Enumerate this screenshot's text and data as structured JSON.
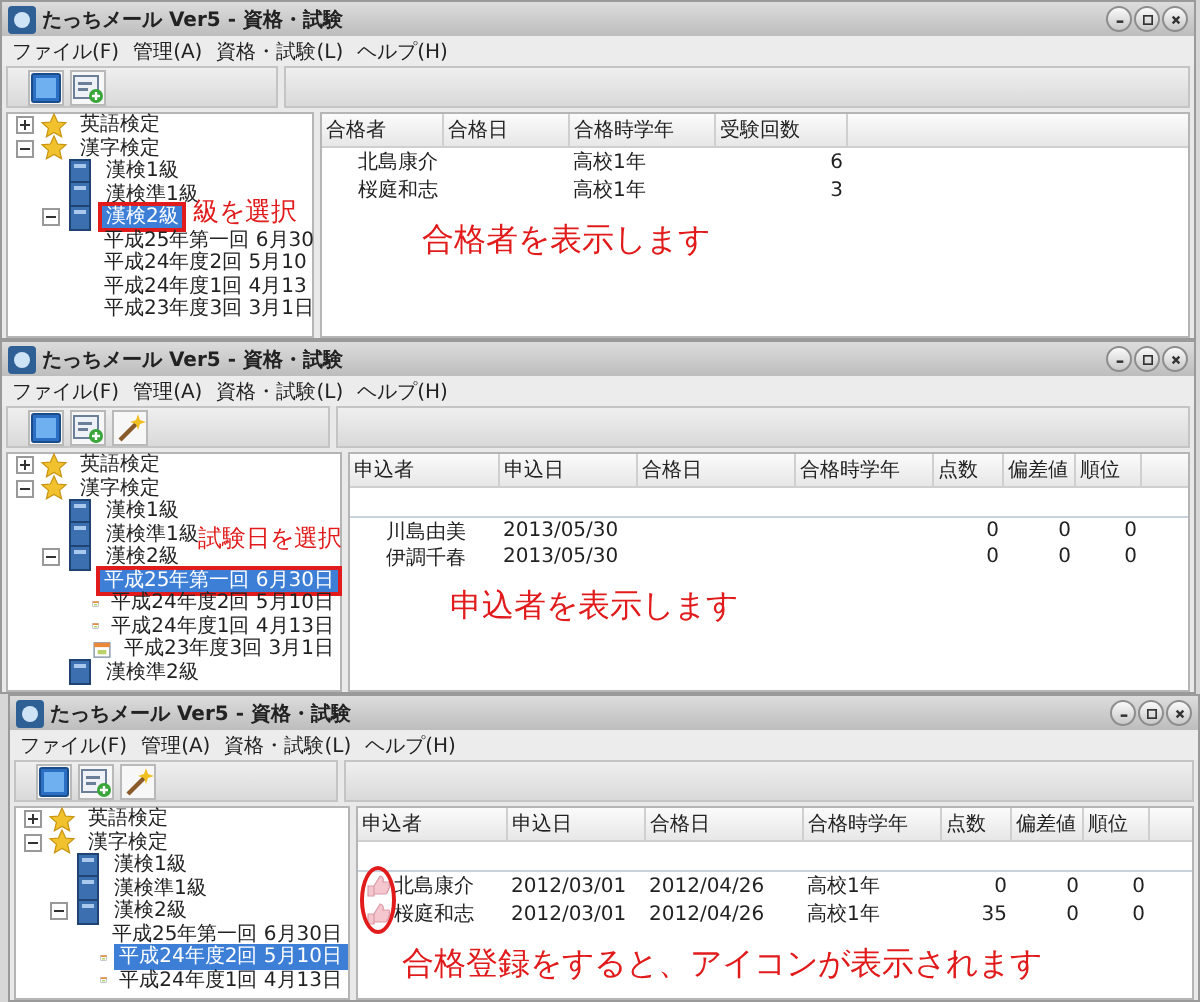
{
  "windows": [
    {
      "title": "たっちメール Ver5 - 資格・試験",
      "menu": [
        "ファイル(F)",
        "管理(A)",
        "資格・試験(L)",
        "ヘルプ(H)"
      ],
      "toolbar": [
        {
          "kind": "window"
        },
        {
          "kind": "add"
        }
      ],
      "tree": [
        {
          "label": "英語検定",
          "kind": "exam",
          "expanded": false,
          "selected": false
        },
        {
          "label": "漢字検定",
          "kind": "exam",
          "expanded": true,
          "selected": false,
          "children": [
            {
              "label": "漢検1級",
              "kind": "grade",
              "selected": false
            },
            {
              "label": "漢検準1級",
              "kind": "grade",
              "selected": false
            },
            {
              "label": "漢検2級",
              "kind": "grade",
              "expanded": true,
              "selected": true,
              "outlined": true,
              "callout": "級を選択",
              "children": [
                {
                  "label": "平成25年第一回 6月30",
                  "kind": "date",
                  "selected": false
                },
                {
                  "label": "平成24年度2回 5月10",
                  "kind": "date",
                  "selected": false
                },
                {
                  "label": "平成24年度1回 4月13",
                  "kind": "date",
                  "selected": false
                },
                {
                  "label": "平成23年度3回 3月1日",
                  "kind": "date",
                  "selected": false
                }
              ]
            }
          ]
        }
      ],
      "table": {
        "columns": [
          {
            "label": "合格者",
            "kind": "text"
          },
          {
            "label": "合格日",
            "kind": "text"
          },
          {
            "label": "合格時学年",
            "kind": "text"
          },
          {
            "label": "受験回数",
            "kind": "number"
          }
        ],
        "rows": [
          {
            "cells": [
              "北島康介",
              null,
              "高校1年",
              "6"
            ]
          },
          {
            "cells": [
              "桜庭和志",
              null,
              "高校1年",
              "3"
            ]
          }
        ],
        "message": "合格者を表示します"
      }
    },
    {
      "title": "たっちメール Ver5 - 資格・試験",
      "menu": [
        "ファイル(F)",
        "管理(A)",
        "資格・試験(L)",
        "ヘルプ(H)"
      ],
      "toolbar": [
        {
          "kind": "window"
        },
        {
          "kind": "add"
        },
        {
          "kind": "wand"
        }
      ],
      "tree": [
        {
          "label": "英語検定",
          "kind": "exam",
          "expanded": false,
          "selected": false
        },
        {
          "label": "漢字検定",
          "kind": "exam",
          "expanded": true,
          "selected": false,
          "children": [
            {
              "label": "漢検1級",
              "kind": "grade",
              "selected": false
            },
            {
              "label": "漢検準1級",
              "kind": "grade",
              "selected": false
            },
            {
              "label": "漢検2級",
              "kind": "grade",
              "expanded": true,
              "selected": false,
              "children": [
                {
                  "label": "平成25年第一回 6月30日",
                  "kind": "date",
                  "selected": true,
                  "outlined": true,
                  "callout": "試験日を選択"
                },
                {
                  "label": "平成24年度2回 5月10日",
                  "kind": "date",
                  "selected": false
                },
                {
                  "label": "平成24年度1回 4月13日",
                  "kind": "date",
                  "selected": false
                },
                {
                  "label": "平成23年度3回 3月1日",
                  "kind": "date",
                  "selected": false
                }
              ]
            },
            {
              "label": "漢検準2級",
              "kind": "grade",
              "selected": false
            }
          ]
        }
      ],
      "table": {
        "columns": [
          {
            "label": "申込者",
            "kind": "text"
          },
          {
            "label": "申込日",
            "kind": "text"
          },
          {
            "label": "合格日",
            "kind": "text"
          },
          {
            "label": "合格時学年",
            "kind": "text"
          },
          {
            "label": "点数",
            "kind": "number"
          },
          {
            "label": "偏差値",
            "kind": "number"
          },
          {
            "label": "順位",
            "kind": "number"
          }
        ],
        "separator": true,
        "rows": [
          {
            "cells": [
              "川島由美",
              "2013/05/30",
              null,
              null,
              "0",
              "0",
              "0"
            ]
          },
          {
            "cells": [
              "伊調千春",
              "2013/05/30",
              null,
              null,
              "0",
              "0",
              "0"
            ]
          }
        ],
        "message": "申込者を表示します"
      }
    },
    {
      "title": "たっちメール Ver5 - 資格・試験",
      "menu": [
        "ファイル(F)",
        "管理(A)",
        "資格・試験(L)",
        "ヘルプ(H)"
      ],
      "toolbar": [
        {
          "kind": "window"
        },
        {
          "kind": "add"
        },
        {
          "kind": "wand"
        }
      ],
      "tree": [
        {
          "label": "英語検定",
          "kind": "exam",
          "expanded": false,
          "selected": false
        },
        {
          "label": "漢字検定",
          "kind": "exam",
          "expanded": true,
          "selected": false,
          "children": [
            {
              "label": "漢検1級",
              "kind": "grade",
              "selected": false
            },
            {
              "label": "漢検準1級",
              "kind": "grade",
              "selected": false
            },
            {
              "label": "漢検2級",
              "kind": "grade",
              "expanded": true,
              "selected": false,
              "children": [
                {
                  "label": "平成25年第一回 6月30日",
                  "kind": "date",
                  "selected": false
                },
                {
                  "label": "平成24年度2回 5月10日",
                  "kind": "date",
                  "selected": true
                },
                {
                  "label": "平成24年度1回 4月13日",
                  "kind": "date",
                  "selected": false
                }
              ]
            }
          ]
        }
      ],
      "table": {
        "columns": [
          {
            "label": "申込者",
            "kind": "text"
          },
          {
            "label": "申込日",
            "kind": "text"
          },
          {
            "label": "合格日",
            "kind": "text"
          },
          {
            "label": "合格時学年",
            "kind": "text"
          },
          {
            "label": "点数",
            "kind": "number"
          },
          {
            "label": "偏差値",
            "kind": "number"
          },
          {
            "label": "順位",
            "kind": "number"
          }
        ],
        "separator": true,
        "circled": true,
        "rows": [
          {
            "passed": true,
            "cells": [
              "北島康介",
              "2012/03/01",
              "2012/04/26",
              "高校1年",
              "0",
              "0",
              "0"
            ]
          },
          {
            "passed": true,
            "cells": [
              "桜庭和志",
              "2012/03/01",
              "2012/04/26",
              "高校1年",
              "35",
              "0",
              "0"
            ]
          }
        ],
        "message": "合格登録をすると、アイコンが表示されます"
      }
    }
  ]
}
